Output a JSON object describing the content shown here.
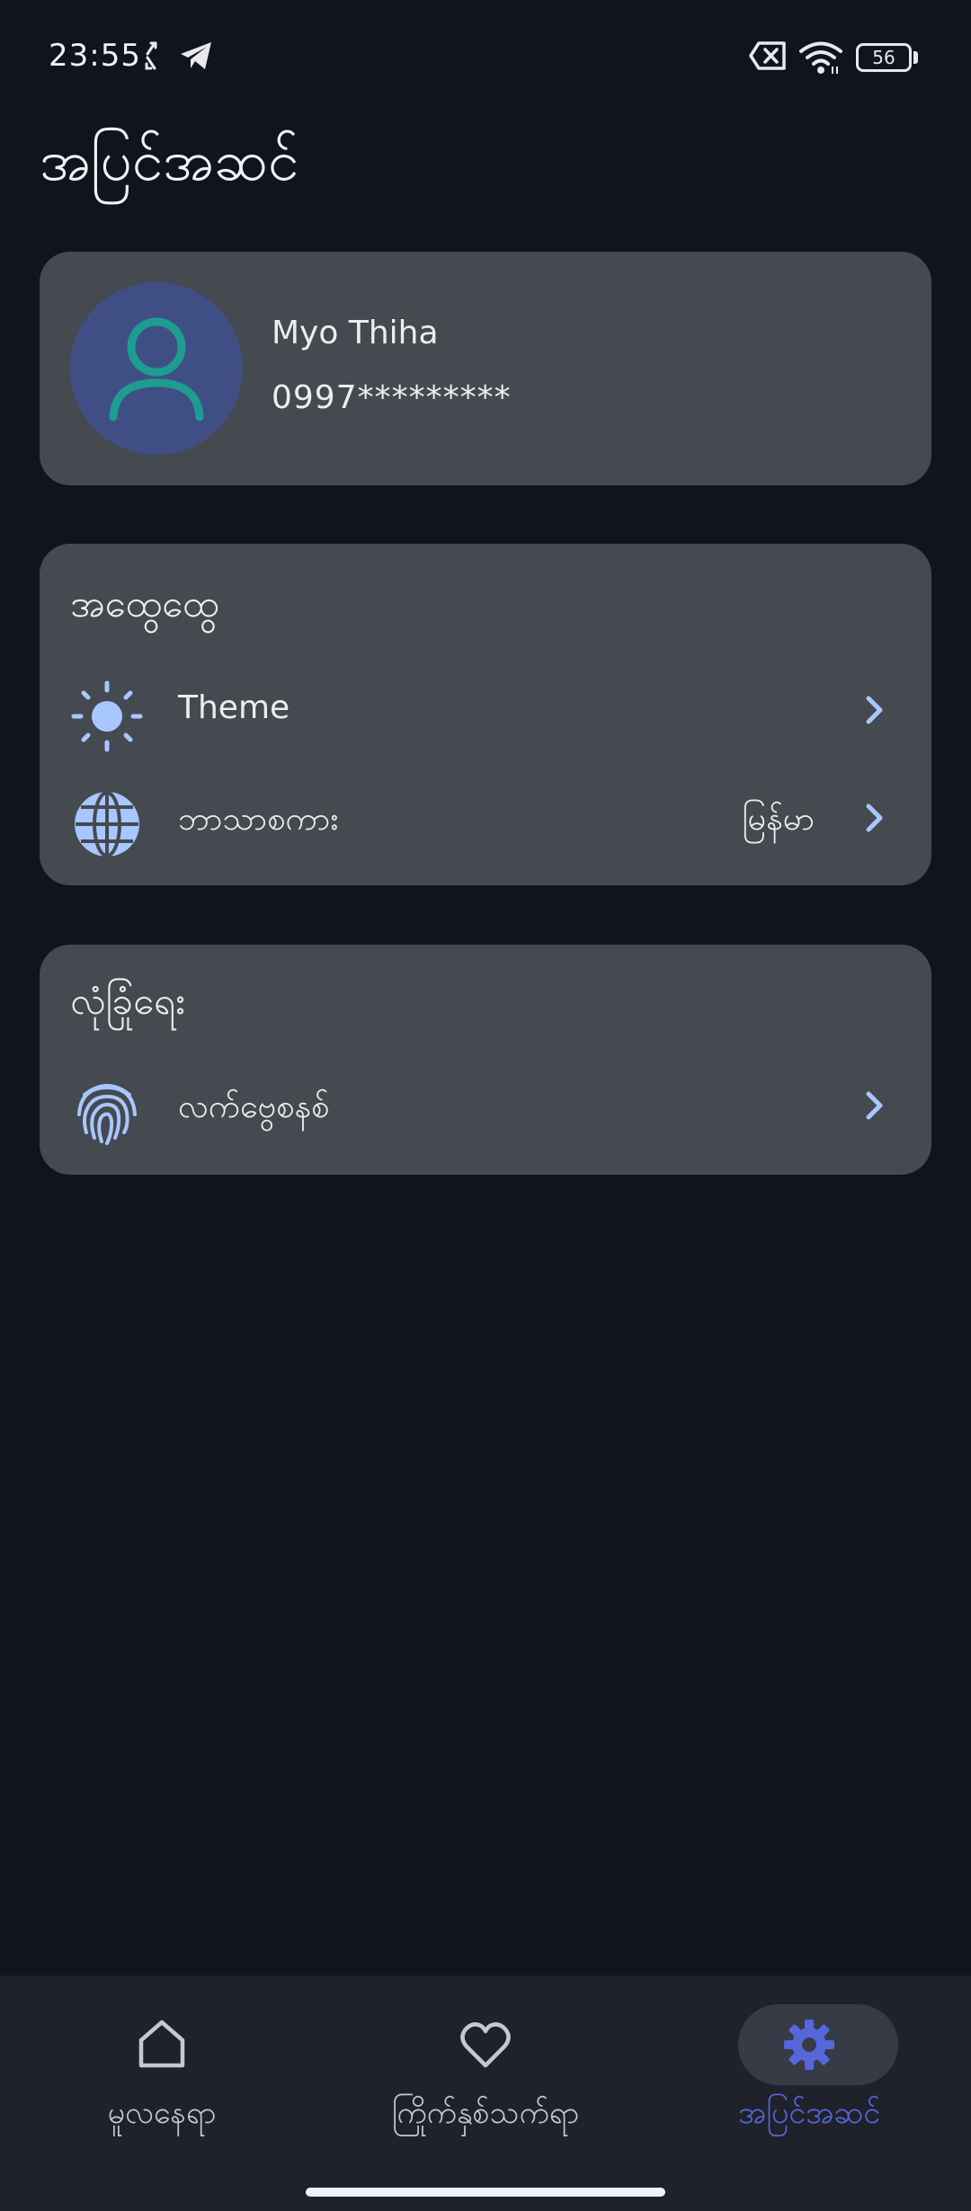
{
  "status_bar": {
    "time": "23:55",
    "battery": "56",
    "icons": [
      "sync-icon",
      "telegram-icon",
      "no-sim-icon",
      "wifi-icon",
      "battery-icon"
    ]
  },
  "page": {
    "title": "အပြင်အဆင်"
  },
  "profile": {
    "name": "Myo Thiha",
    "phone": "0997*********",
    "avatar_icon": "person-icon"
  },
  "general": {
    "title": "အထွေထွေ",
    "theme": {
      "label": "Theme",
      "icon": "sun-icon"
    },
    "language": {
      "label": "ဘာသာစကား",
      "value": "မြန်မာ",
      "icon": "globe-icon"
    }
  },
  "security": {
    "title": "လုံခြုံရေး",
    "fingerprint": {
      "label": "လက်ဗွေစနစ်",
      "icon": "fingerprint-icon"
    }
  },
  "nav": {
    "home": "မူလနေရာ",
    "favorites": "ကြိုက်နှစ်သက်ရာ",
    "settings": "အပြင်အဆင်"
  },
  "colors": {
    "background": "#11141c",
    "card": "#454950",
    "accent": "#5567d9",
    "icon_blue": "#a9c7ff",
    "avatar_bg": "#3f4f85",
    "avatar_icon": "#1c9d8f"
  }
}
